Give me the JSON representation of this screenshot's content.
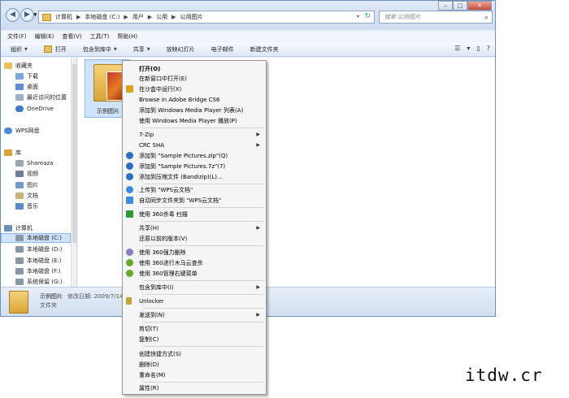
{
  "colors": {
    "accent": "#cfe3fb",
    "frame": "#6d8fb8"
  },
  "titlebar": {
    "back": "◀",
    "forward": "▶",
    "dropdown": "▼",
    "breadcrumb": [
      "计算机",
      "本地磁盘 (C:)",
      "用户",
      "公用",
      "公用图片"
    ],
    "separator": "▶",
    "search_placeholder": "搜索 公用图片",
    "search_icon": "magnifier-icon",
    "refresh": "↻",
    "addr_arrow": "▾",
    "min": "‒",
    "max": "□",
    "close": "✕"
  },
  "menubar": [
    "文件(F)",
    "编辑(E)",
    "查看(V)",
    "工具(T)",
    "帮助(H)"
  ],
  "toolbar": {
    "items": [
      {
        "label": "组织",
        "arrow": "▼"
      },
      {
        "label": "打开",
        "arrow": ""
      },
      {
        "label": "包含到库中",
        "arrow": "▼"
      },
      {
        "label": "共享",
        "arrow": "▼"
      },
      {
        "label": "放映幻灯片",
        "arrow": ""
      },
      {
        "label": "电子邮件",
        "arrow": ""
      },
      {
        "label": "新建文件夹",
        "arrow": ""
      }
    ],
    "right": [
      "☰",
      "▾",
      "▯",
      "?"
    ]
  },
  "nav": [
    {
      "label": "收藏夹",
      "icon": "star-icon",
      "color": "#e8c15a"
    },
    {
      "label": "下载",
      "icon": "download-folder-icon",
      "color": "#7ba6d8"
    },
    {
      "label": "桌面",
      "icon": "desktop-icon",
      "color": "#5b8fd0"
    },
    {
      "label": "最近访问的位置",
      "icon": "recent-icon",
      "color": "#9ab0c8"
    },
    {
      "label": "OneDrive",
      "icon": "cloud-icon",
      "color": "#3e7cc9"
    },
    {
      "label": "WPS网盘",
      "icon": "wps-cloud-icon",
      "color": "#4a8ed6"
    },
    {
      "label": "库",
      "icon": "library-icon",
      "color": "#d9a437"
    },
    {
      "label": "Shareaza",
      "icon": "library-folder-icon",
      "color": "#9aa6b4"
    },
    {
      "label": "视频",
      "icon": "video-icon",
      "color": "#6f7f93"
    },
    {
      "label": "图片",
      "icon": "pictures-icon",
      "color": "#6f9bc6"
    },
    {
      "label": "文档",
      "icon": "documents-icon",
      "color": "#c8b37a"
    },
    {
      "label": "音乐",
      "icon": "music-icon",
      "color": "#5a8cc8"
    },
    {
      "label": "计算机",
      "icon": "computer-icon",
      "color": "#6d8fb8"
    },
    {
      "label": "本地磁盘 (C:)",
      "icon": "drive-icon",
      "color": "#8a96a6"
    },
    {
      "label": "本地磁盘 (D:)",
      "icon": "drive-icon",
      "color": "#8a96a6"
    },
    {
      "label": "本地磁盘 (E:)",
      "icon": "drive-icon",
      "color": "#8a96a6"
    },
    {
      "label": "本地磁盘 (F:)",
      "icon": "drive-icon",
      "color": "#8a96a6"
    },
    {
      "label": "系统保留 (G:)",
      "icon": "drive-icon",
      "color": "#8a96a6"
    }
  ],
  "content": {
    "file_label": "示例图片"
  },
  "status": {
    "name": "示例图片",
    "date": "修改日期: 2009/7/14",
    "type": "文件夹"
  },
  "context_menu": {
    "items": [
      {
        "label": "打开(O)",
        "bold": true,
        "icon": "",
        "sub": ""
      },
      {
        "label": "在新窗口中打开(E)",
        "icon": "",
        "sub": ""
      },
      {
        "label": "在沙盒中运行(X)",
        "icon": "sandbox-icon",
        "icon_color": "#e0a020",
        "sub": ""
      },
      {
        "label": "Browse in Adobe Bridge CS6",
        "icon": "",
        "sub": ""
      },
      {
        "label": "添加到 Windows Media Player 列表(A)",
        "icon": "",
        "sub": ""
      },
      {
        "label": "使用 Windows Media Player 播放(P)",
        "icon": "",
        "sub": ""
      },
      {
        "label": "7-Zip",
        "icon": "",
        "sub": "▶"
      },
      {
        "label": "CRC SHA",
        "icon": "",
        "sub": "▶"
      },
      {
        "label": "添加到 \"Sample Pictures.zip\"(Q)",
        "icon": "bandizip-icon",
        "icon_color": "#2c6fc4",
        "sub": ""
      },
      {
        "label": "添加到 \"Sample Pictures.7z\"(7)",
        "icon": "bandizip-icon",
        "icon_color": "#2c6fc4",
        "sub": ""
      },
      {
        "label": "添加到压缩文件 (Bandizip)(L)...",
        "icon": "bandizip-icon",
        "icon_color": "#2c6fc4",
        "sub": ""
      },
      {
        "label": "上传到 \"WPS云文档\"",
        "icon": "wps-upload-icon",
        "icon_color": "#3b8be0",
        "sub": ""
      },
      {
        "label": "自动同步文件夹到 \"WPS云文档\"",
        "icon": "wps-sync-icon",
        "icon_color": "#3b8be0",
        "sub": ""
      },
      {
        "label": "使用 360杀毒 扫描",
        "icon": "360-antivirus-icon",
        "icon_color": "#2e9a3c",
        "sub": ""
      },
      {
        "label": "共享(H)",
        "icon": "",
        "sub": "▶"
      },
      {
        "label": "还原以前的版本(V)",
        "icon": "",
        "sub": ""
      },
      {
        "label": "使用 360强力删除",
        "icon": "360-delete-icon",
        "icon_color": "#8e7cc3",
        "sub": ""
      },
      {
        "label": "使用 360进行木马云查杀",
        "icon": "360-trojan-icon",
        "icon_color": "#6aa82a",
        "sub": ""
      },
      {
        "label": "使用 360管理右键菜单",
        "icon": "360-menu-icon",
        "icon_color": "#6aa82a",
        "sub": ""
      },
      {
        "label": "包含到库中(I)",
        "icon": "",
        "sub": "▶"
      },
      {
        "label": "Unlocker",
        "icon": "unlocker-icon",
        "icon_color": "#c7a13a",
        "sub": ""
      },
      {
        "label": "发送到(N)",
        "icon": "",
        "sub": "▶"
      },
      {
        "label": "剪切(T)",
        "icon": "",
        "sub": ""
      },
      {
        "label": "复制(C)",
        "icon": "",
        "sub": ""
      },
      {
        "label": "创建快捷方式(S)",
        "icon": "",
        "sub": ""
      },
      {
        "label": "删除(D)",
        "icon": "",
        "sub": ""
      },
      {
        "label": "重命名(M)",
        "icon": "",
        "sub": ""
      },
      {
        "label": "属性(R)",
        "icon": "",
        "sub": ""
      }
    ]
  },
  "watermark": "itdw.cr"
}
